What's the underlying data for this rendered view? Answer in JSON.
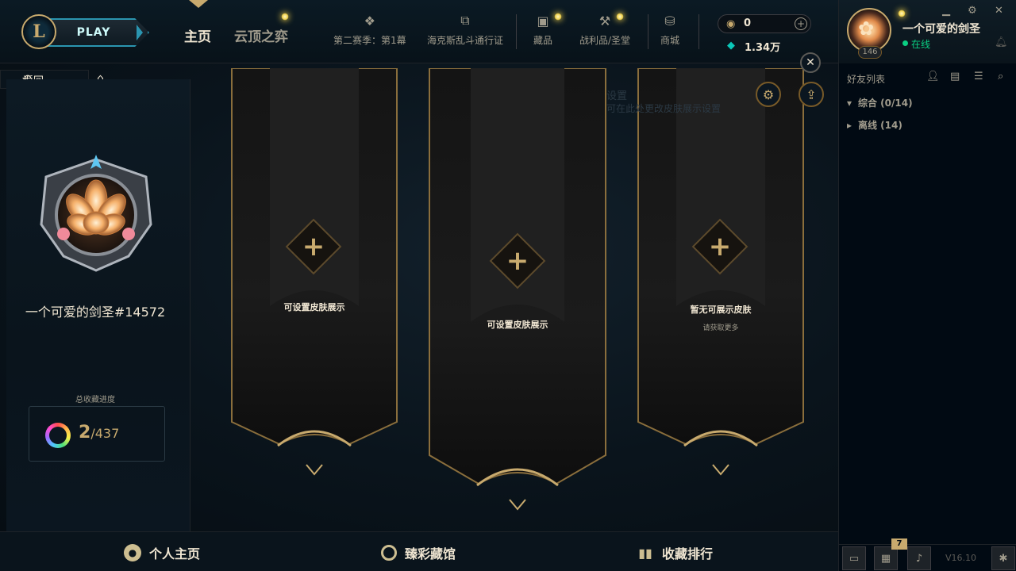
{
  "topbar": {
    "logo": "L",
    "play_label": "PLAY",
    "nav_home": "主页",
    "nav_tft": "云顶之弈",
    "items": [
      {
        "label": "第二赛季：第1幕",
        "icon": "card-icon"
      },
      {
        "label": "海克斯乱斗通行证",
        "icon": "pass-icon"
      },
      {
        "label": "藏品",
        "icon": "collection-bag-icon"
      },
      {
        "label": "战利品/圣堂",
        "icon": "loot-icon"
      },
      {
        "label": "商城",
        "icon": "coins-icon"
      }
    ],
    "rp_value": "0",
    "be_value": "1.34万",
    "rp_add": "+"
  },
  "social": {
    "username": "一个可爱的剑圣",
    "status": "在线",
    "level": "146",
    "friends_title": "好友列表",
    "groups": [
      {
        "label": "综合 (0/14)",
        "caret": "▾"
      },
      {
        "label": "离线 (14)",
        "caret": "▸"
      }
    ],
    "notif_count": "7",
    "version": "V16.10"
  },
  "content": {
    "back_label": "返回",
    "player_name": "一个可爱的剑圣#14572",
    "progress_label": "总收藏进度",
    "progress_count": "2",
    "progress_total": "/437",
    "settings_title": "设置",
    "settings_hint": "可在此处更改皮肤展示设置",
    "banners": [
      {
        "title": "可设置皮肤展示",
        "sub": ""
      },
      {
        "title": "可设置皮肤展示",
        "sub": ""
      },
      {
        "title": "暂无可展示皮肤",
        "sub": "请获取更多"
      }
    ]
  },
  "bottom_nav": {
    "profile": "个人主页",
    "collection": "臻彩藏馆",
    "ranking": "收藏排行"
  },
  "colors": {
    "gold": "#c8aa6e",
    "teal": "#2b95b0",
    "online": "#0acf83",
    "background": "#010a13"
  }
}
